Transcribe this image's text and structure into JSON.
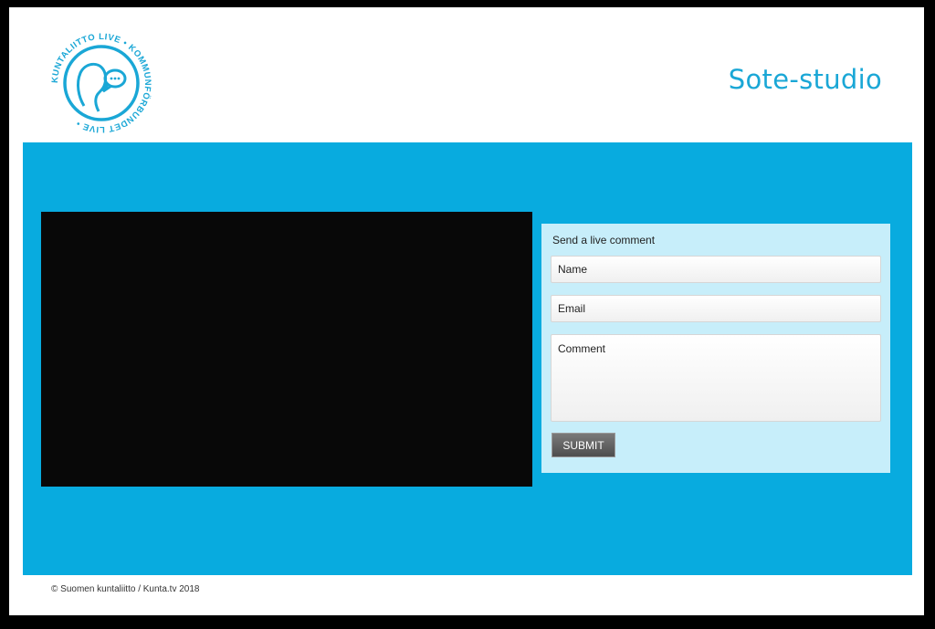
{
  "colors": {
    "brand": "#1aa7d6",
    "stage": "#08abdf",
    "panel": "#c7eefa",
    "video": "#080808"
  },
  "header": {
    "logo": {
      "icon": "kuntaliitto-live-logo",
      "ring_text": "KUNTALIITTO LIVE • KOMMUNFÖRBUNDET LIVE •"
    },
    "site_title": "Sote-studio"
  },
  "comment_form": {
    "title": "Send a live comment",
    "name_placeholder": "Name",
    "email_placeholder": "Email",
    "comment_placeholder": "Comment",
    "submit_label": "SUBMIT"
  },
  "footer": {
    "copyright": "© Suomen kuntaliitto / Kunta.tv 2018"
  }
}
